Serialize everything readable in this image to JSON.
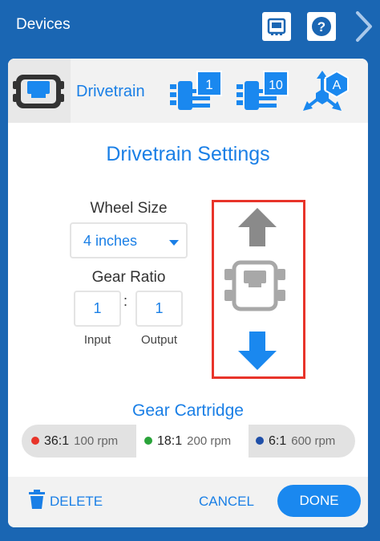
{
  "header": {
    "title": "Devices"
  },
  "tabs": {
    "active_label": "Drivetrain",
    "motor_one_badge": "1",
    "motor_ten_badge": "10",
    "inertial_badge": "A"
  },
  "settings": {
    "title": "Drivetrain Settings",
    "wheel_size_label": "Wheel Size",
    "wheel_size_value": "4 inches",
    "gear_ratio_label": "Gear Ratio",
    "gear_ratio_separator": ":",
    "input_value": "1",
    "output_value": "1",
    "input_label": "Input",
    "output_label": "Output"
  },
  "cartridge": {
    "title": "Gear Cartridge",
    "options": [
      {
        "ratio": "36:1",
        "rpm": "100 rpm",
        "color": "#e8342a",
        "selected": false
      },
      {
        "ratio": "18:1",
        "rpm": "200 rpm",
        "color": "#2aa33a",
        "selected": true
      },
      {
        "ratio": "6:1",
        "rpm": "600 rpm",
        "color": "#1f4fa8",
        "selected": false
      }
    ]
  },
  "footer": {
    "delete_label": "DELETE",
    "cancel_label": "CANCEL",
    "done_label": "DONE"
  },
  "colors": {
    "primary": "#1a66b3",
    "accent": "#1a88ef",
    "highlight_border": "#e8342a"
  },
  "icons": [
    "device-icon",
    "help-icon",
    "chevron-right-icon",
    "drivetrain-icon",
    "motor-icon",
    "inertial-sensor-icon",
    "arrow-up-icon",
    "robot-icon",
    "arrow-down-icon",
    "trash-icon"
  ]
}
